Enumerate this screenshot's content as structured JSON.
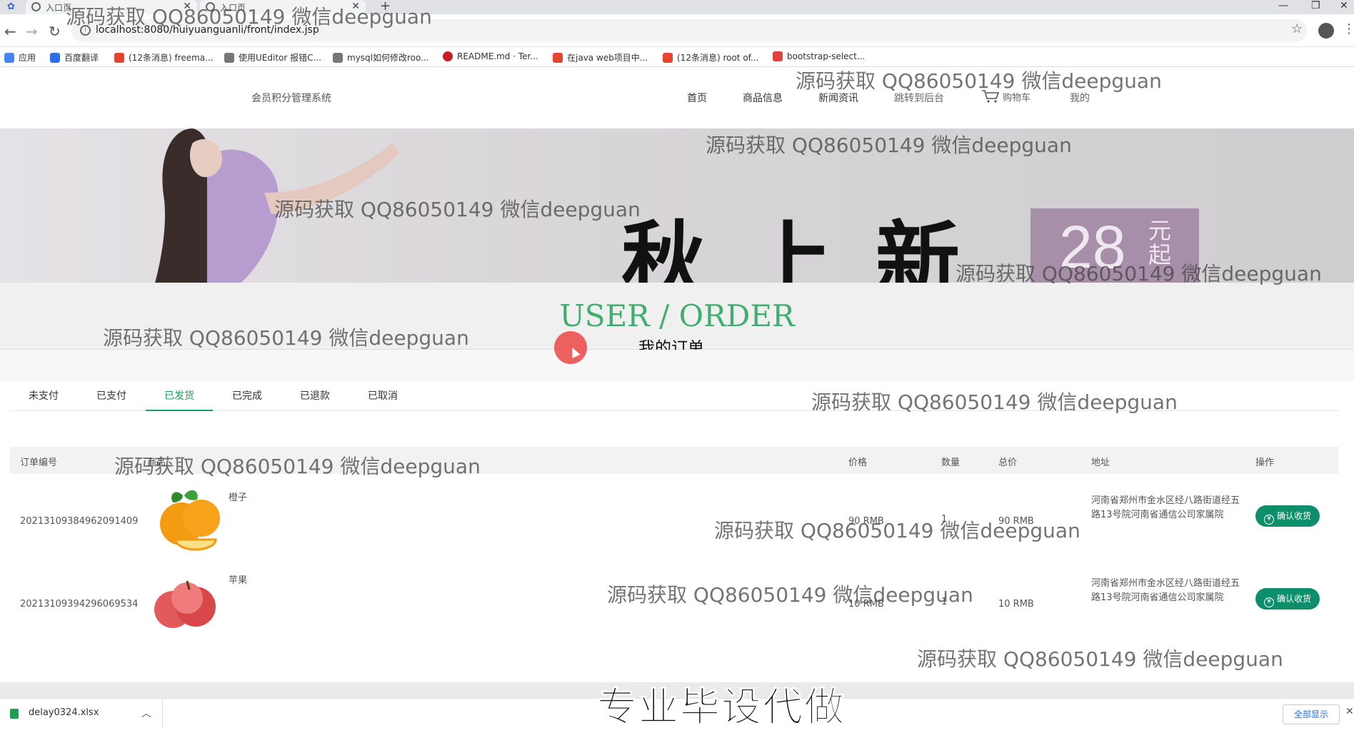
{
  "browser": {
    "tabs": [
      {
        "label": "入口页"
      },
      {
        "label": "入口页"
      }
    ],
    "new_tab": "+",
    "url": "localhost:8080/huiyuanguanli/front/index.jsp",
    "bookmarks": [
      {
        "label": "应用",
        "color": "#4285f4"
      },
      {
        "label": "百度翻译",
        "color": "#2a6ee8"
      },
      {
        "label": "(12条消息) freema...",
        "color": "#e2462f"
      },
      {
        "label": "使用UEditor 报错C...",
        "color": "#555555"
      },
      {
        "label": "mysql如何修改roo...",
        "color": "#555555"
      },
      {
        "label": "README.md · Ter...",
        "color": "#c71d23"
      },
      {
        "label": "在java web项目中...",
        "color": "#e2462f"
      },
      {
        "label": "(12条消息) root of...",
        "color": "#e2462f"
      },
      {
        "label": "bootstrap-select...",
        "color": "#d9453c"
      }
    ]
  },
  "header": {
    "brand": "会员积分管理系统",
    "nav": [
      "首页",
      "商品信息",
      "新闻资讯",
      "跳转到后台",
      "购物车",
      "我的"
    ]
  },
  "banner": {
    "title": "秋上新",
    "price": "28",
    "price_unit": "元起"
  },
  "page_title": {
    "en": "USER / ORDER",
    "cn": "我的订单"
  },
  "order_tabs": [
    "未支付",
    "已支付",
    "已发货",
    "已完成",
    "已退款",
    "已取消"
  ],
  "active_tab_index": 2,
  "table": {
    "headers": [
      "订单编号",
      "商品",
      "价格",
      "数量",
      "总价",
      "地址",
      "操作"
    ],
    "rows": [
      {
        "order_no": "20213109384962091409",
        "product": "橙子",
        "price": "90 RMB",
        "qty": "1",
        "total": "90 RMB",
        "address": "河南省郑州市金水区经八路街道经五路13号院河南省通信公司家属院",
        "action": "确认收货"
      },
      {
        "order_no": "20213109394296069534",
        "product": "苹果",
        "price": "10 RMB",
        "qty": "1",
        "total": "10 RMB",
        "address": "河南省郑州市金水区经八路街道经五路13号院河南省通信公司家属院",
        "action": "确认收货"
      }
    ]
  },
  "download": {
    "file": "delay0324.xlsx",
    "show_all": "全部显示"
  },
  "watermark": "源码获取 QQ86050149 微信deepguan",
  "caption": "专业毕设代做"
}
